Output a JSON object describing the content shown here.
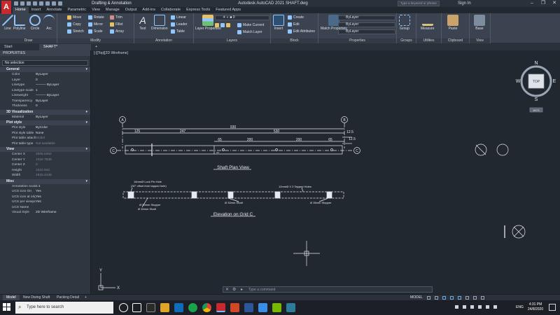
{
  "title_bar": {
    "workspace": "Drafting & Annotation",
    "app_title": "Autodesk AutoCAD 2021   SHAFT.dwg",
    "search_placeholder": "Type a keyword or phrase",
    "sign_in": "Sign In"
  },
  "ribbon_tabs": [
    "Home",
    "Insert",
    "Annotate",
    "Parametric",
    "View",
    "Manage",
    "Output",
    "Add-ins",
    "Collaborate",
    "Express Tools",
    "Featured Apps"
  ],
  "ribbon": {
    "draw": {
      "label": "Draw",
      "line": "Line",
      "polyline": "Polyline",
      "circle": "Circle",
      "arc": "Arc"
    },
    "modify": {
      "label": "Modify",
      "move": "Move",
      "rotate": "Rotate",
      "trim": "Trim",
      "copy": "Copy",
      "mirror": "Mirror",
      "fillet": "Fillet",
      "stretch": "Stretch",
      "scale": "Scale",
      "array": "Array"
    },
    "annotation": {
      "label": "Annotation",
      "text": "Text",
      "dimension": "Dimension",
      "linear": "Linear",
      "leader": "Leader",
      "table": "Table"
    },
    "layers": {
      "label": "Layers",
      "layer_properties": "Layer Properties",
      "make_current": "Make Current",
      "match_layer": "Match Layer"
    },
    "block": {
      "label": "Block",
      "insert": "Insert",
      "create": "Create",
      "edit": "Edit",
      "edit_attributes": "Edit Attributes"
    },
    "properties": {
      "label": "Properties",
      "match_properties": "Match Properties",
      "bylayer_color": "ByLayer",
      "bylayer_linetype": "ByLayer",
      "bylayer_lineweight": "ByLayer"
    },
    "groups": {
      "label": "Groups",
      "group": "Group"
    },
    "utilities": {
      "label": "Utilities",
      "measure": "Measure"
    },
    "clipboard": {
      "label": "Clipboard",
      "paste": "Paste"
    },
    "view": {
      "label": "View",
      "base": "Base"
    }
  },
  "file_tabs": [
    "Start",
    "SHAFT*"
  ],
  "properties_palette": {
    "title": "PROPERTIES",
    "selection": "No selection",
    "sections": [
      {
        "name": "General",
        "rows": [
          {
            "k": "Color",
            "v": "ByLayer"
          },
          {
            "k": "Layer",
            "v": "0"
          },
          {
            "k": "Linetype",
            "v": "——— ByLayer"
          },
          {
            "k": "Linetype scale",
            "v": "1"
          },
          {
            "k": "Lineweight",
            "v": "——— ByLayer"
          },
          {
            "k": "Transparency",
            "v": "ByLayer"
          },
          {
            "k": "Thickness",
            "v": "0"
          }
        ]
      },
      {
        "name": "3D Visualization",
        "rows": [
          {
            "k": "Material",
            "v": "ByLayer"
          }
        ]
      },
      {
        "name": "Plot style",
        "rows": [
          {
            "k": "Plot style",
            "v": "ByColor"
          },
          {
            "k": "Plot style table",
            "v": "None"
          },
          {
            "k": "Plot table attached to",
            "v": "Model"
          },
          {
            "k": "Plot table type",
            "v": "Not available"
          }
        ]
      },
      {
        "name": "View",
        "rows": [
          {
            "k": "Center X",
            "v": "2666.8362"
          },
          {
            "k": "Center Y",
            "v": "1332.7838"
          },
          {
            "k": "Center Z",
            "v": "0"
          },
          {
            "k": "Height",
            "v": "1022.942"
          },
          {
            "k": "Width",
            "v": "1815.4448"
          }
        ]
      },
      {
        "name": "Misc",
        "rows": [
          {
            "k": "Annotation scale",
            "v": "1:1"
          },
          {
            "k": "UCS icon On",
            "v": "Yes"
          },
          {
            "k": "UCS icon at origin",
            "v": "Yes"
          },
          {
            "k": "UCS per viewport",
            "v": "Yes"
          },
          {
            "k": "UCS Name",
            "v": ""
          },
          {
            "k": "Visual Style",
            "v": "2D Wireframe"
          }
        ]
      }
    ]
  },
  "canvas": {
    "view_label": "[-][Top][2D Wireframe]",
    "viewcube": {
      "top": "TOP",
      "n": "N",
      "s": "S",
      "e": "E",
      "w": "W",
      "wcs": "WCS"
    },
    "plan_view_title": "Shaft Plan View",
    "elevation_title": "Elevation on Grid C",
    "grid_a": "A",
    "grid_b": "B",
    "grid_c": "C",
    "dims": {
      "overall": "930",
      "d125": "125",
      "d247": "247",
      "d530": "530",
      "d12_5a": "12.5",
      "d12_5b": "12.5",
      "d200a": "200",
      "d200b": "200",
      "d65a": "65",
      "d65b": "65"
    },
    "notes": {
      "lock_pin": "16mmØ Lock Pin Hole",
      "lock_pin_offset": "(30° offset from tapped hole)",
      "tapped_holes": "12mmØ X 3 Tapped Holes",
      "stopper_50": "Ø 50mm Stopper",
      "shaft_30": "Ø 30mm Shaft",
      "shaft_32": "Ø 32mm Shaft",
      "stopper_35": "Ø 35mm Stopper"
    },
    "ucs": {
      "x": "X",
      "y": "Y"
    }
  },
  "command_line": {
    "placeholder": "Type a command"
  },
  "layout_tabs": [
    "Model",
    "New Dwing Shaft",
    "Packing Detail"
  ],
  "status_bar": {
    "model": "MODEL"
  },
  "taskbar": {
    "search_placeholder": "Type here to search",
    "lang": "ENG",
    "time": "4:31 PM",
    "date": "24/8/2020"
  }
}
